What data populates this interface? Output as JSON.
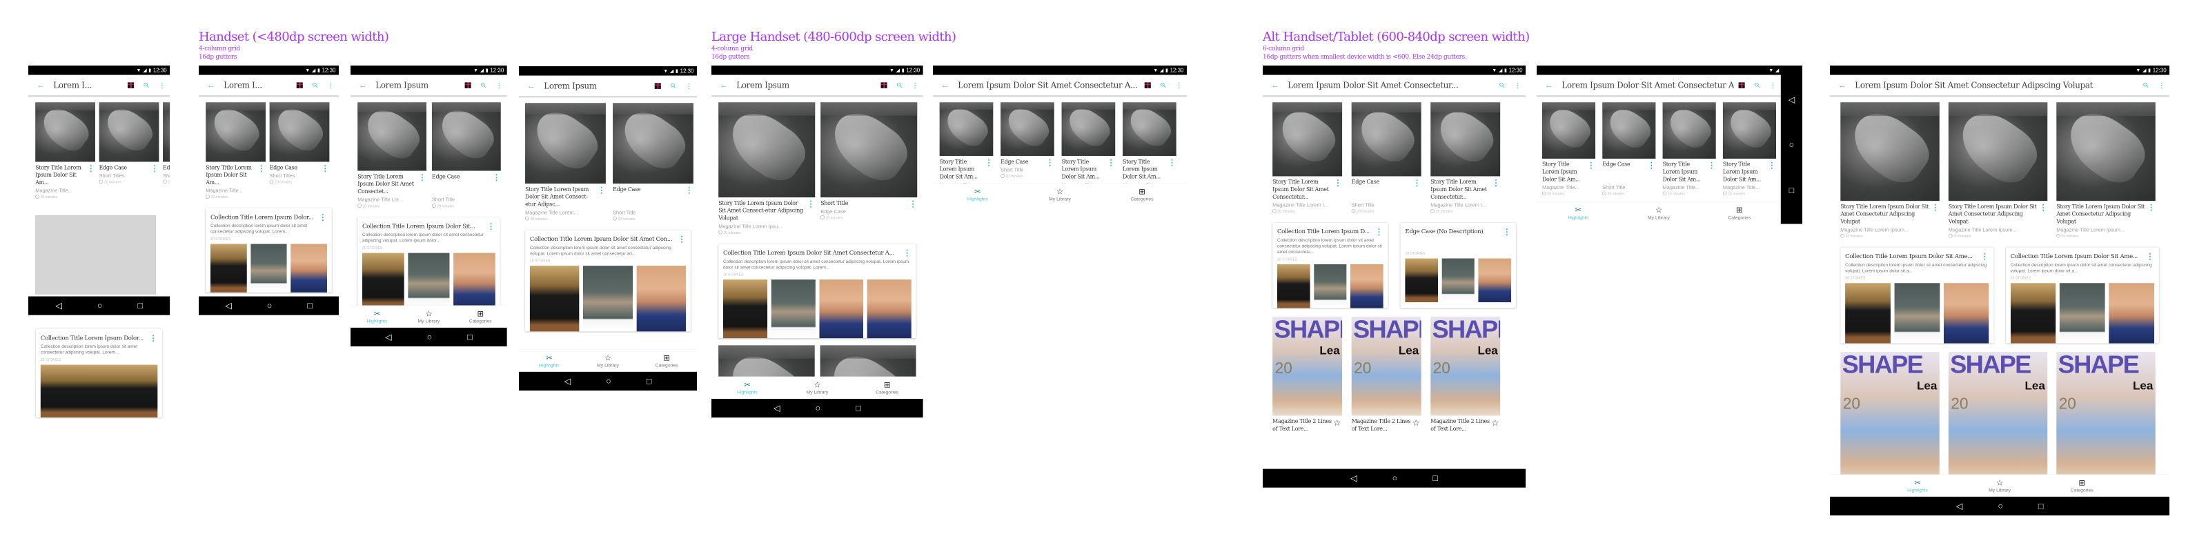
{
  "sections": [
    {
      "title": "Handset (<480dp screen width)",
      "lines": [
        "4-column grid",
        "16dp gutters"
      ]
    },
    {
      "title": "Large Handset (480-600dp screen width)",
      "lines": [
        "4-column grid",
        "16dp gutters"
      ]
    },
    {
      "title": "Alt Handset/Tablet (600-840dp screen width)",
      "lines": [
        "6-column grid",
        "16dp gutters when smallest device width is <600. Else 24dp gutters."
      ]
    }
  ],
  "status_time": "12:30",
  "bottom_nav": [
    {
      "label": "Highlights",
      "icon": "highlights-icon",
      "active": true
    },
    {
      "label": "My Library",
      "icon": "star-icon",
      "active": false
    },
    {
      "label": "Categories",
      "icon": "grid-icon",
      "active": false
    }
  ],
  "colors": {
    "accent": "#4dc4d6",
    "section_heading": "#aa33ff",
    "status_bar": "#000000"
  },
  "panels": [
    {
      "app_title": "Lorem I...",
      "show_gift": true,
      "bottom_nav": false,
      "stories": [
        {
          "title": "Story Title Lorem Ipsum Dolor Sit Am...",
          "subtitle": "Magazine Title...",
          "time": "20 minutes"
        },
        {
          "title": "Edge Case",
          "subtitle": "Short Titles",
          "time": "20 minutes"
        },
        {
          "title": "Edge Case",
          "subtitle": "Short Titles",
          "time": "20 minutes"
        }
      ],
      "collections": [],
      "magazines": []
    },
    {
      "app_title": "Lorem I...",
      "show_gift": true,
      "bottom_nav": false,
      "stories": [
        {
          "title": "Story Title Lorem Ipsum Dolor Sit Am...",
          "subtitle": "Magazine Title...",
          "time": "20 minutes"
        },
        {
          "title": "Edge Case",
          "subtitle": "Short Titles",
          "time": "20 minutes"
        }
      ],
      "collections": [
        {
          "title": "Collection Title Lorem Ipsum Dolor...",
          "desc": "Collection description lorem ipsum dolor sit amet consectetur adipscing volupat. Lorem...",
          "count": "20 STORIES",
          "thumbs": [
            "man",
            "woman",
            "general"
          ]
        }
      ],
      "magazines": []
    },
    {
      "app_title": "Lorem Ipsum",
      "show_gift": true,
      "bottom_nav": true,
      "stories": [
        {
          "title": "Story Title Lorem Ipsum Dolor Sit Amet Consectet...",
          "subtitle": "Magazine Title Lor...",
          "time": "20 minutes"
        },
        {
          "title": "Edge Case",
          "subtitle": "Short Title",
          "time": "20 minutes"
        }
      ],
      "collections": [
        {
          "title": "Collection Title Lorem Ipsum Dolor Sit...",
          "desc": "Collection description lorem ipsum dolor sit amet consectetur adipscing volupat. Lorem ipsum dolor...",
          "count": "20 STORIES",
          "thumbs": [
            "man",
            "woman",
            "general"
          ]
        }
      ],
      "magazines": []
    },
    {
      "app_title": "Lorem Ipsum",
      "show_gift": true,
      "bottom_nav": true,
      "stories": [
        {
          "title": "Story Title Lorem Ipsum Dolor Sit Amet Consect-etur Adipsc...",
          "subtitle": "Magazine Title Lorem...",
          "time": "20 minutes"
        },
        {
          "title": "Edge Case",
          "subtitle": "Short Title",
          "time": "20 minutes"
        }
      ],
      "collections": [
        {
          "title": "Collection Title Lorem Ipsum Dolor Sit Amet Con...",
          "desc": "Collection description lorem ipsum dolor sit amet consectetur adipscing volupat. Lorem ipsum dolor sit amet consectetur ad...",
          "count": "20 STORIES",
          "thumbs": [
            "man",
            "woman",
            "general"
          ]
        }
      ],
      "magazines": []
    },
    {
      "app_title": "Lorem Ipsum",
      "show_gift": true,
      "bottom_nav": true,
      "stories": [
        {
          "title": "Story Title Lorem Ipsum Dolor Sit Amet Consect-etur Adipscing Volupat",
          "subtitle": "Magazine Title Lorem Ipsu...",
          "time": "20 minutes"
        },
        {
          "title": "Short Title",
          "subtitle": "Edge Case",
          "time": "20 minutes"
        }
      ],
      "collections": [
        {
          "title": "Collection Title Lorem Ipsum Dolor Sit Amet Consectetur A...",
          "desc": "Collection description lorem ipsum dolor sit amet consectetur adipscing volupat. Lorem ipsum dolor sit amet consectetur adipscing volupat. Lorem...",
          "count": "20 STORIES",
          "thumbs": [
            "man",
            "woman",
            "general",
            "general"
          ]
        }
      ],
      "magazines": []
    },
    {
      "app_title": "Lorem Ipsum Dolor Sit Amet Consectetur A...",
      "show_gift": true,
      "bottom_nav": true,
      "stories": [
        {
          "title": "Story Title Lorem Ipsum Dolor Sit Am...",
          "subtitle": "Magazine Title...",
          "time": "20 minutes"
        },
        {
          "title": "Edge Case",
          "subtitle": "Short Title",
          "time": "20 minutes"
        },
        {
          "title": "Story Title Lorem Ipsum Dolor Sit Am...",
          "subtitle": "Magazine Title...",
          "time": "20 minutes"
        },
        {
          "title": "Story Title Lorem Ipsum Dolor Sit Am...",
          "subtitle": "Magazine Title...",
          "time": "20 minutes"
        }
      ],
      "collections": [],
      "magazines": []
    },
    {
      "app_title": "Lorem Ipsum Dolor Sit Amet Consectetur...",
      "show_gift": false,
      "bottom_nav": false,
      "stories": [
        {
          "title": "Story Title Lorem Ipsum Dolor Sit Amet Consectetur...",
          "subtitle": "Magazine Title Lorem I...",
          "time": "20 minutes"
        },
        {
          "title": "Edge Case",
          "subtitle": "Short Title",
          "time": "20 minutes"
        },
        {
          "title": "Story Title Lorem Ipsum Dolor Sit Amet Consectetur...",
          "subtitle": "Magazine Title Lorem I...",
          "time": "20 minutes"
        }
      ],
      "collections": [
        {
          "title": "Collection Title Lorem Ipsum D...",
          "desc": "Collection description lorem ipsum dolor sit amet consectetur adipscing volupat. Lorem ipsum dolor sit amet consectetu...",
          "count": "20 STORIES",
          "thumbs": [
            "man",
            "woman",
            "general"
          ]
        },
        {
          "title": "Edge Case (No Description)",
          "desc": "",
          "count": "20 STORIES",
          "thumbs": [
            "man",
            "woman",
            "general"
          ]
        }
      ],
      "magazines": [
        {
          "caption": "Magazine Title 2 Lines of Text Lore...",
          "logo": "SHAPE",
          "cover_name": "Lea",
          "cover_number": "20"
        },
        {
          "caption": "Magazine Title 2 Lines of Text Lore...",
          "logo": "SHAPE",
          "cover_name": "Lea",
          "cover_number": "20"
        },
        {
          "caption": "Magazine Title 2 Lines of Text Lore...",
          "logo": "SHAPE",
          "cover_name": "Lea",
          "cover_number": "20"
        }
      ]
    },
    {
      "app_title": "Lorem Ipsum Dolor Sit Amet Consectetur Adip...",
      "show_gift": true,
      "bottom_nav": true,
      "stories": [
        {
          "title": "Story Title Lorem Ipsum Dolor Sit Am...",
          "subtitle": "Magazine Title...",
          "time": "20 minutes"
        },
        {
          "title": "Edge Case",
          "subtitle": "Short Title",
          "time": "20 minutes"
        },
        {
          "title": "Story Title Lorem Ipsum Dolor Sit Am...",
          "subtitle": "Magazine Title...",
          "time": "20 minutes"
        },
        {
          "title": "Story Title Lorem Ipsum Dolor Sit Am...",
          "subtitle": "Magazine Title...",
          "time": "20 minutes"
        }
      ],
      "collections": [],
      "magazines": []
    },
    {
      "app_title": "Lorem Ipsum Dolor Sit Amet Consectetur Adipscing Volupat",
      "show_gift": false,
      "bottom_nav": true,
      "stories": [
        {
          "title": "Story Title Lorem Ipsum Dolor Sit Amet Consectetur Adipscing Volupat",
          "subtitle": "Magazine Title Lorem Ipsum...",
          "time": "20 minutes"
        },
        {
          "title": "Story Title Lorem Ipsum Dolor Sit Amet Consectetur Adipscing Volupat",
          "subtitle": "Magazine Title Lorem Ipsum...",
          "time": "20 minutes"
        },
        {
          "title": "Story Title Lorem Ipsum Dolor Sit Amet Consectetur Adipscing Volupat",
          "subtitle": "Magazine Title Lorem Ipsum...",
          "time": "20 minutes"
        }
      ],
      "collections": [
        {
          "title": "Collection Title Lorem Ipsum Dolor Sit Ame...",
          "desc": "Collection description lorem ipsum dolor sit amet consectetur adipscing volupat. Lorem ipsum dolor sit a...",
          "count": "20 STORIES",
          "thumbs": [
            "man",
            "woman",
            "general"
          ]
        },
        {
          "title": "Collection Title Lorem Ipsum Dolor Sit Ame...",
          "desc": "Collection description lorem ipsum dolor sit amet consectetur adipscing volupat. Lorem ipsum dolor sit a...",
          "count": "20 STORIES",
          "thumbs": [
            "man",
            "woman",
            "general"
          ]
        }
      ],
      "magazines": [
        {
          "caption": "",
          "logo": "SHAPE",
          "cover_name": "Lea",
          "cover_number": "20"
        },
        {
          "caption": "",
          "logo": "SHAPE",
          "cover_name": "Lea",
          "cover_number": "20"
        },
        {
          "caption": "",
          "logo": "SHAPE",
          "cover_name": "Lea",
          "cover_number": "20"
        }
      ]
    }
  ],
  "standalone_collection": {
    "title": "Collection Title Lorem Ipsum Dolor...",
    "desc": "Collection description lorem ipsum dolor sit amet consectetur adipscing volupat. Lorem...",
    "count": "20 STORIES",
    "thumbs": [
      "man"
    ]
  }
}
